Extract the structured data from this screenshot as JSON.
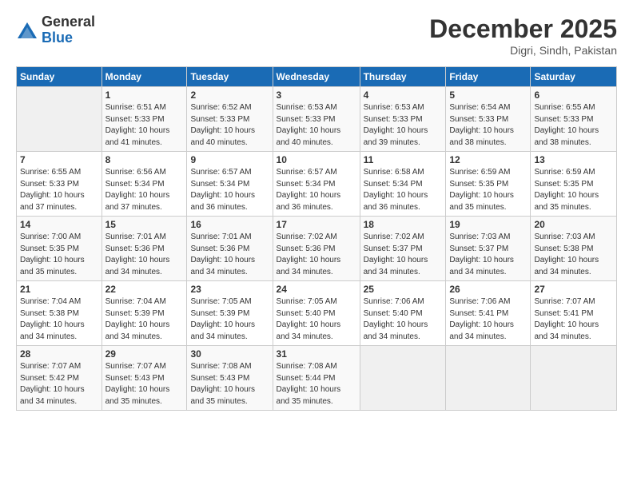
{
  "header": {
    "logo": {
      "general": "General",
      "blue": "Blue"
    },
    "title": "December 2025",
    "location": "Digri, Sindh, Pakistan"
  },
  "calendar": {
    "days_of_week": [
      "Sunday",
      "Monday",
      "Tuesday",
      "Wednesday",
      "Thursday",
      "Friday",
      "Saturday"
    ],
    "weeks": [
      [
        {
          "day": null
        },
        {
          "day": "1",
          "sunrise": "6:51 AM",
          "sunset": "5:33 PM",
          "daylight": "10 hours and 41 minutes."
        },
        {
          "day": "2",
          "sunrise": "6:52 AM",
          "sunset": "5:33 PM",
          "daylight": "10 hours and 40 minutes."
        },
        {
          "day": "3",
          "sunrise": "6:53 AM",
          "sunset": "5:33 PM",
          "daylight": "10 hours and 40 minutes."
        },
        {
          "day": "4",
          "sunrise": "6:53 AM",
          "sunset": "5:33 PM",
          "daylight": "10 hours and 39 minutes."
        },
        {
          "day": "5",
          "sunrise": "6:54 AM",
          "sunset": "5:33 PM",
          "daylight": "10 hours and 38 minutes."
        },
        {
          "day": "6",
          "sunrise": "6:55 AM",
          "sunset": "5:33 PM",
          "daylight": "10 hours and 38 minutes."
        }
      ],
      [
        {
          "day": "7",
          "sunrise": "6:55 AM",
          "sunset": "5:33 PM",
          "daylight": "10 hours and 37 minutes."
        },
        {
          "day": "8",
          "sunrise": "6:56 AM",
          "sunset": "5:34 PM",
          "daylight": "10 hours and 37 minutes."
        },
        {
          "day": "9",
          "sunrise": "6:57 AM",
          "sunset": "5:34 PM",
          "daylight": "10 hours and 36 minutes."
        },
        {
          "day": "10",
          "sunrise": "6:57 AM",
          "sunset": "5:34 PM",
          "daylight": "10 hours and 36 minutes."
        },
        {
          "day": "11",
          "sunrise": "6:58 AM",
          "sunset": "5:34 PM",
          "daylight": "10 hours and 36 minutes."
        },
        {
          "day": "12",
          "sunrise": "6:59 AM",
          "sunset": "5:35 PM",
          "daylight": "10 hours and 35 minutes."
        },
        {
          "day": "13",
          "sunrise": "6:59 AM",
          "sunset": "5:35 PM",
          "daylight": "10 hours and 35 minutes."
        }
      ],
      [
        {
          "day": "14",
          "sunrise": "7:00 AM",
          "sunset": "5:35 PM",
          "daylight": "10 hours and 35 minutes."
        },
        {
          "day": "15",
          "sunrise": "7:01 AM",
          "sunset": "5:36 PM",
          "daylight": "10 hours and 34 minutes."
        },
        {
          "day": "16",
          "sunrise": "7:01 AM",
          "sunset": "5:36 PM",
          "daylight": "10 hours and 34 minutes."
        },
        {
          "day": "17",
          "sunrise": "7:02 AM",
          "sunset": "5:36 PM",
          "daylight": "10 hours and 34 minutes."
        },
        {
          "day": "18",
          "sunrise": "7:02 AM",
          "sunset": "5:37 PM",
          "daylight": "10 hours and 34 minutes."
        },
        {
          "day": "19",
          "sunrise": "7:03 AM",
          "sunset": "5:37 PM",
          "daylight": "10 hours and 34 minutes."
        },
        {
          "day": "20",
          "sunrise": "7:03 AM",
          "sunset": "5:38 PM",
          "daylight": "10 hours and 34 minutes."
        }
      ],
      [
        {
          "day": "21",
          "sunrise": "7:04 AM",
          "sunset": "5:38 PM",
          "daylight": "10 hours and 34 minutes."
        },
        {
          "day": "22",
          "sunrise": "7:04 AM",
          "sunset": "5:39 PM",
          "daylight": "10 hours and 34 minutes."
        },
        {
          "day": "23",
          "sunrise": "7:05 AM",
          "sunset": "5:39 PM",
          "daylight": "10 hours and 34 minutes."
        },
        {
          "day": "24",
          "sunrise": "7:05 AM",
          "sunset": "5:40 PM",
          "daylight": "10 hours and 34 minutes."
        },
        {
          "day": "25",
          "sunrise": "7:06 AM",
          "sunset": "5:40 PM",
          "daylight": "10 hours and 34 minutes."
        },
        {
          "day": "26",
          "sunrise": "7:06 AM",
          "sunset": "5:41 PM",
          "daylight": "10 hours and 34 minutes."
        },
        {
          "day": "27",
          "sunrise": "7:07 AM",
          "sunset": "5:41 PM",
          "daylight": "10 hours and 34 minutes."
        }
      ],
      [
        {
          "day": "28",
          "sunrise": "7:07 AM",
          "sunset": "5:42 PM",
          "daylight": "10 hours and 34 minutes."
        },
        {
          "day": "29",
          "sunrise": "7:07 AM",
          "sunset": "5:43 PM",
          "daylight": "10 hours and 35 minutes."
        },
        {
          "day": "30",
          "sunrise": "7:08 AM",
          "sunset": "5:43 PM",
          "daylight": "10 hours and 35 minutes."
        },
        {
          "day": "31",
          "sunrise": "7:08 AM",
          "sunset": "5:44 PM",
          "daylight": "10 hours and 35 minutes."
        },
        {
          "day": null
        },
        {
          "day": null
        },
        {
          "day": null
        }
      ]
    ]
  }
}
